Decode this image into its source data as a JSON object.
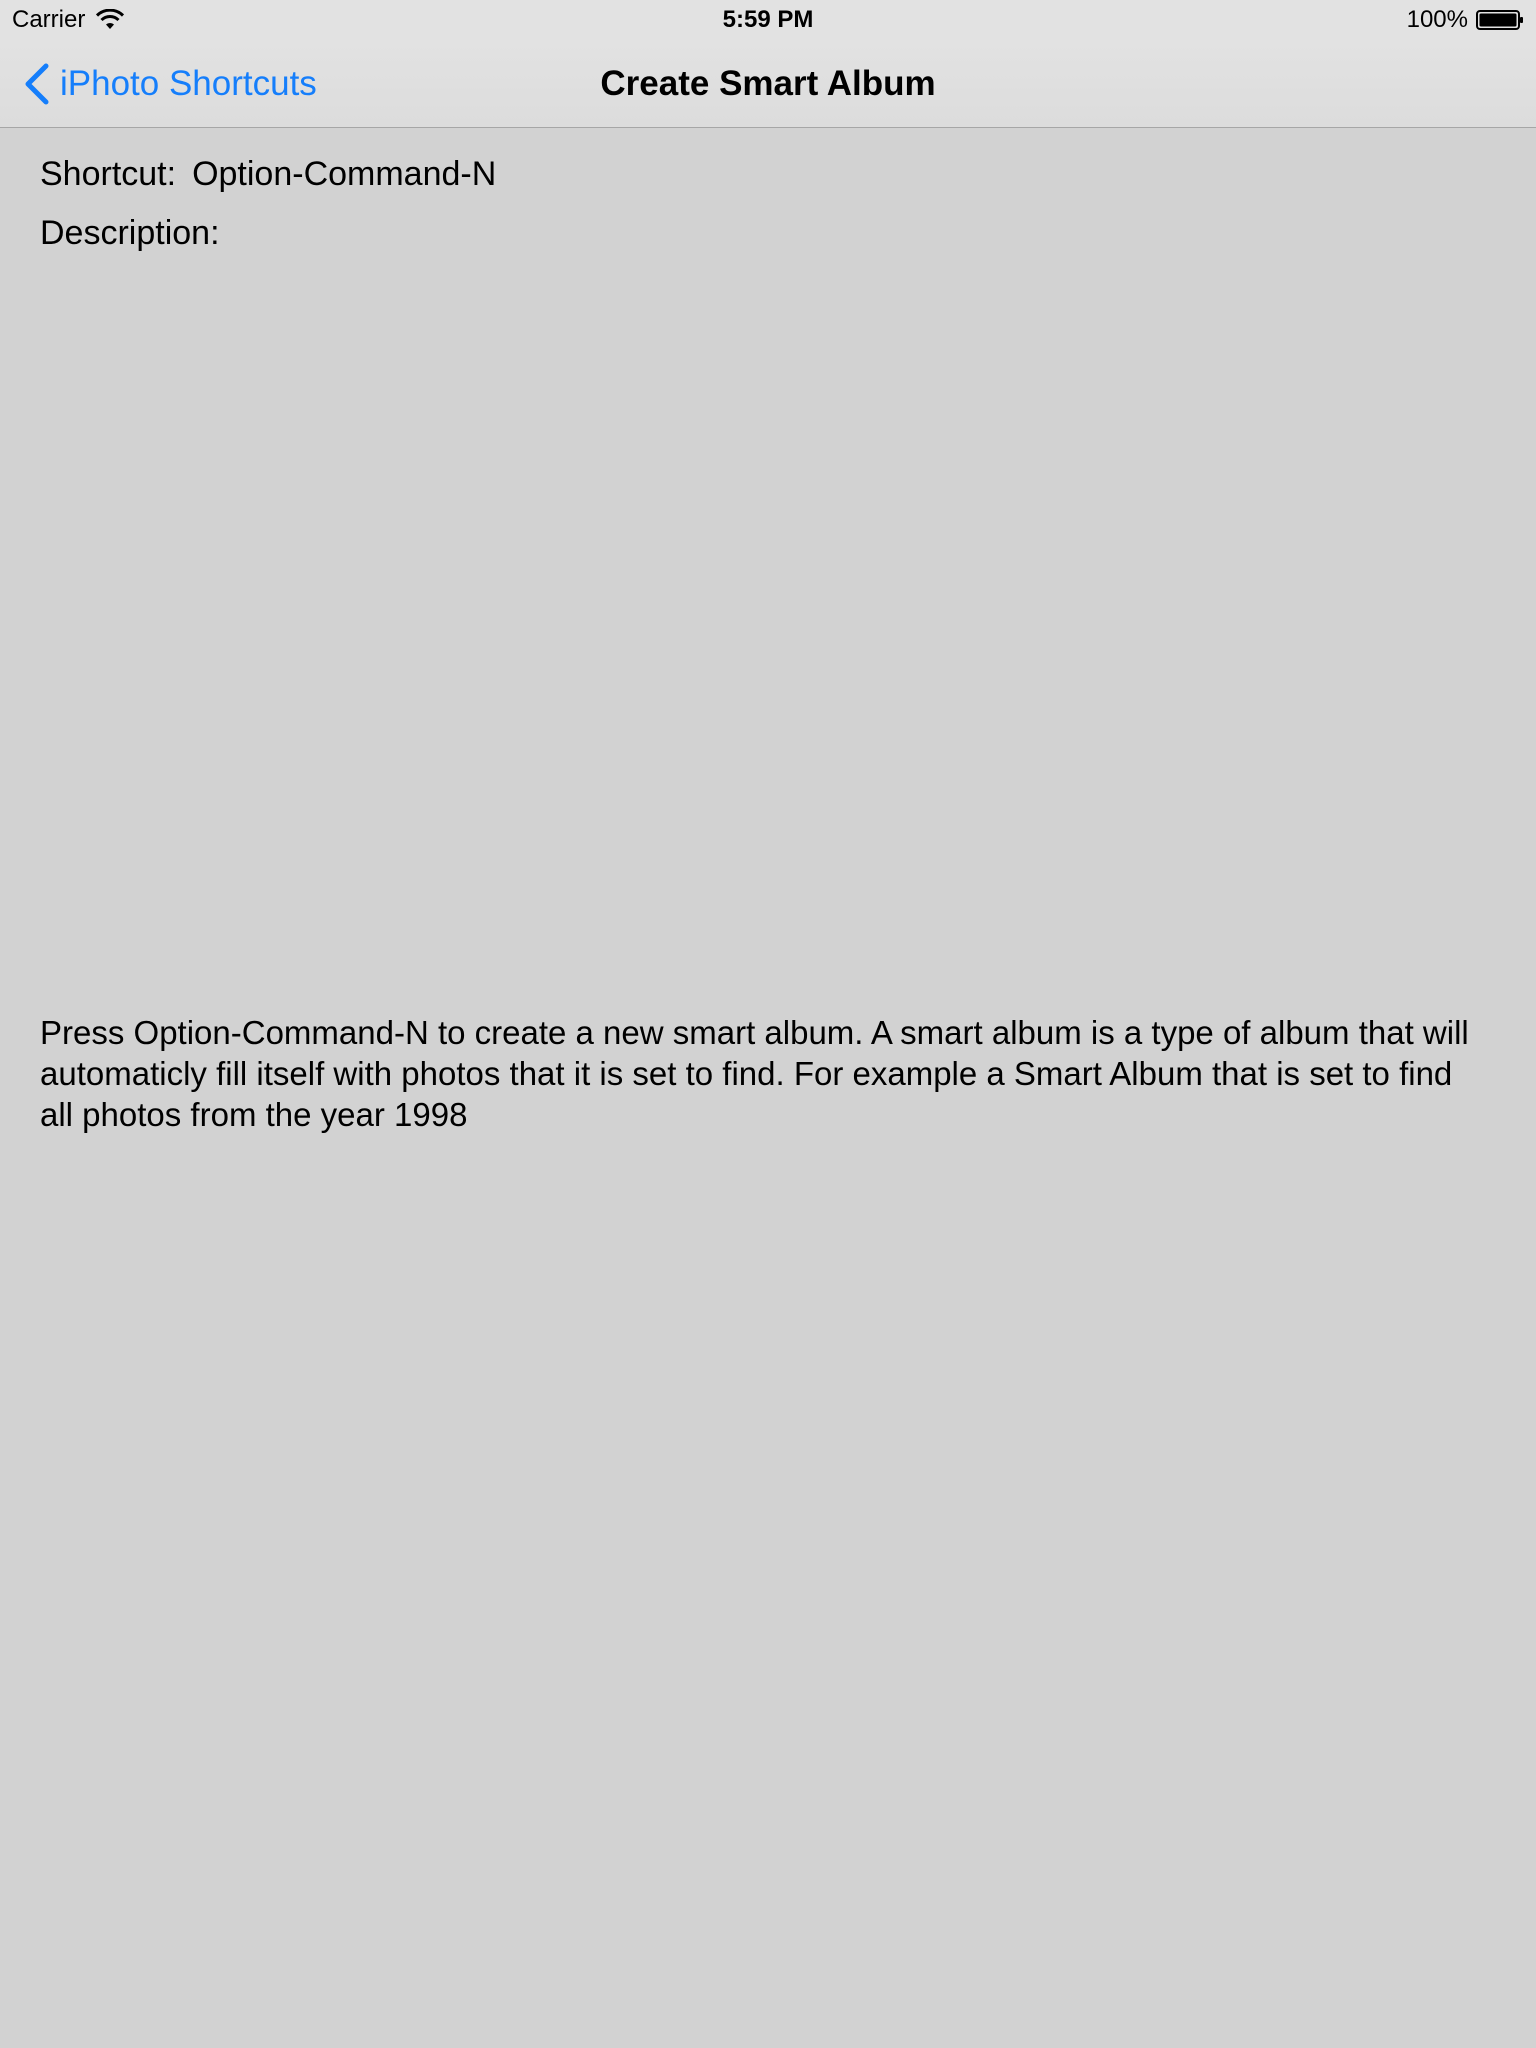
{
  "status_bar": {
    "carrier": "Carrier",
    "time": "5:59 PM",
    "battery": "100%"
  },
  "nav_bar": {
    "back_label": "iPhoto Shortcuts",
    "title": "Create Smart Album"
  },
  "detail": {
    "shortcut_label": "Shortcut:",
    "shortcut_value": "Option-Command-N",
    "description_label": "Description:",
    "description_text": "Press Option-Command-N to create a new smart album. A smart album is a type of album that will automaticly fill itself with photos that it is set to find. For example a Smart Album that is set to find all photos from the year 1998"
  },
  "colors": {
    "background": "#d2d2d2",
    "bar_background": "#e2e2e2",
    "accent": "#157efb"
  },
  "icons": {
    "wifi": "wifi-icon",
    "battery": "battery-icon",
    "back": "chevron-left-icon"
  }
}
